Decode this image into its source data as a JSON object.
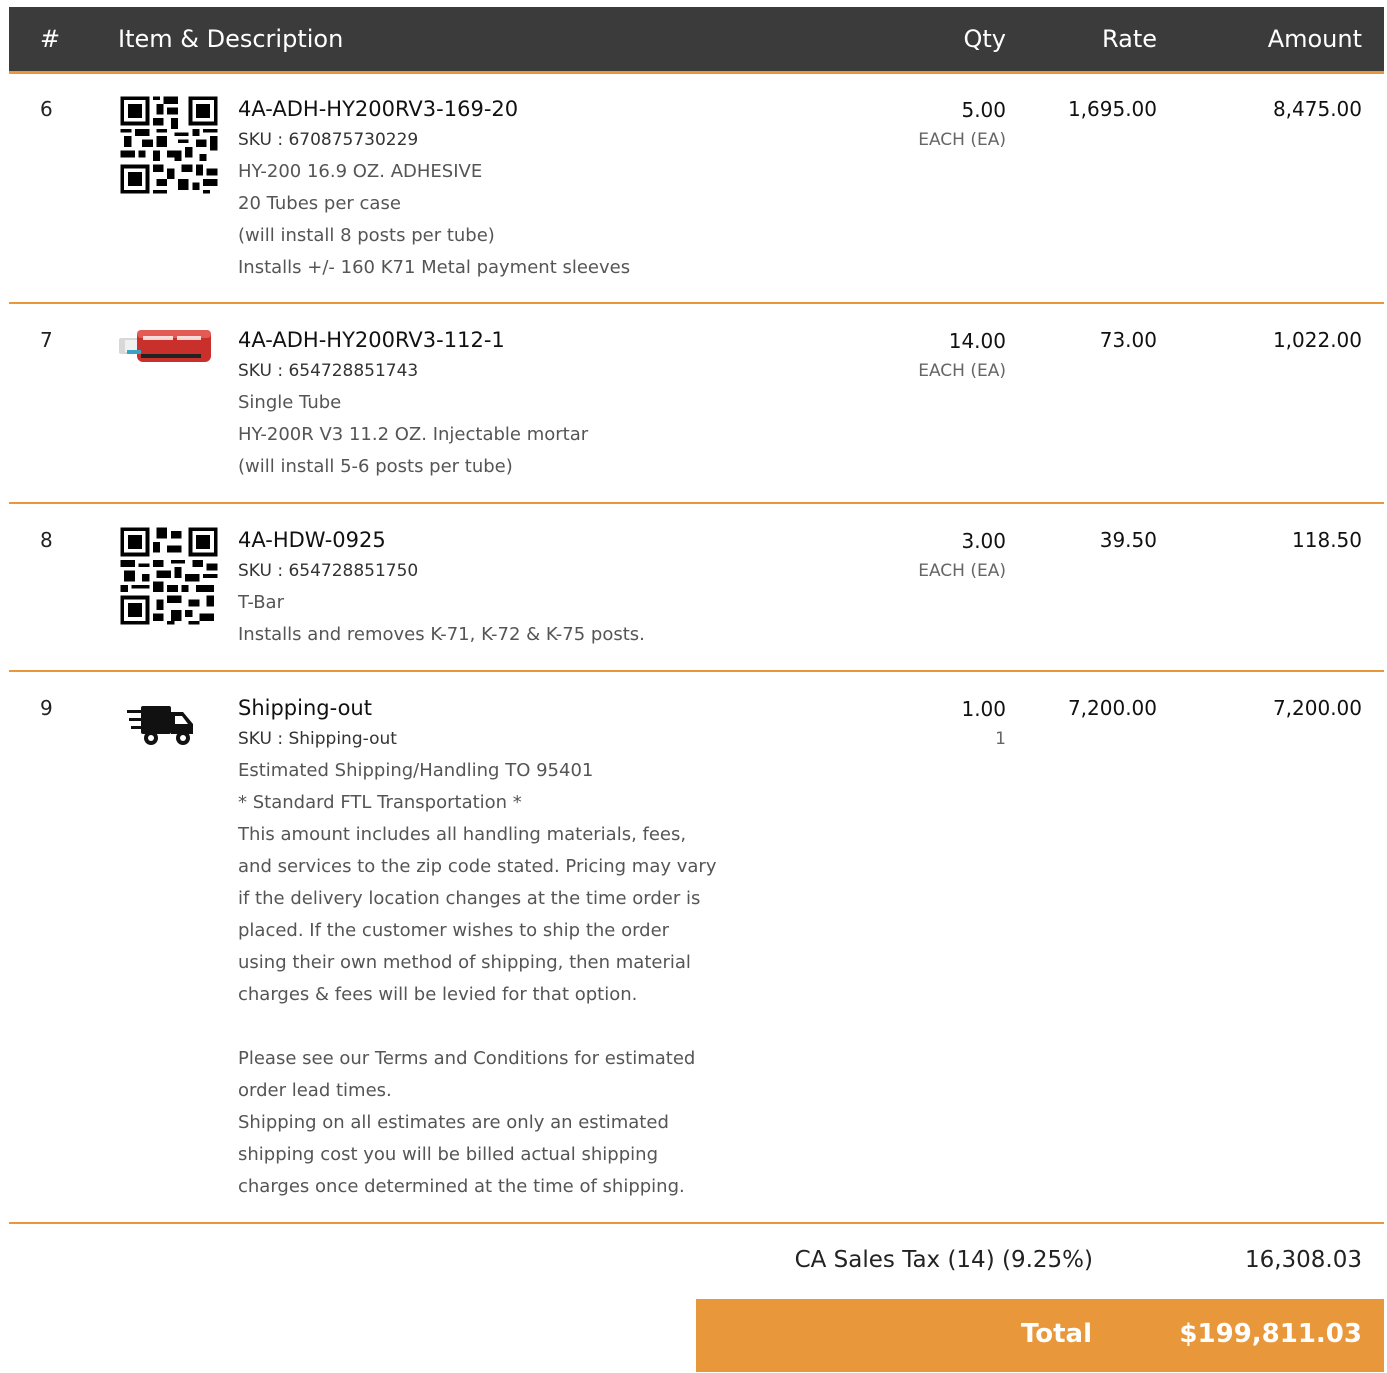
{
  "table_header": {
    "num": "#",
    "item": "Item & Description",
    "qty": "Qty",
    "rate": "Rate",
    "amount": "Amount"
  },
  "items": [
    {
      "num": "6",
      "image": "qr-code",
      "name": "4A-ADH-HY200RV3-169-20",
      "sku": "SKU : 670875730229",
      "lines": [
        "HY-200 16.9 OZ. ADHESIVE",
        "20 Tubes per case",
        "(will install 8 posts per tube)",
        "Installs +/- 160 K71 Metal payment sleeves"
      ],
      "qty": "5.00",
      "unit": "EACH (EA)",
      "rate": "1,695.00",
      "amount": "8,475.00"
    },
    {
      "num": "7",
      "image": "adhesive-tube",
      "name": "4A-ADH-HY200RV3-112-1",
      "sku": "SKU : 654728851743",
      "lines": [
        "Single Tube",
        "HY-200R V3 11.2 OZ. Injectable mortar",
        "(will install 5-6 posts per tube)"
      ],
      "qty": "14.00",
      "unit": "EACH (EA)",
      "rate": "73.00",
      "amount": "1,022.00"
    },
    {
      "num": "8",
      "image": "qr-code",
      "name": "4A-HDW-0925",
      "sku": "SKU : 654728851750",
      "lines": [
        "T-Bar",
        "Installs and removes K-71, K-72 & K-75 posts."
      ],
      "qty": "3.00",
      "unit": "EACH (EA)",
      "rate": "39.50",
      "amount": "118.50"
    },
    {
      "num": "9",
      "image": "delivery-truck",
      "name": "Shipping-out",
      "sku": "SKU : Shipping-out",
      "lines": [
        "Estimated Shipping/Handling TO 95401",
        "* Standard FTL Transportation *",
        "This amount includes all handling materials, fees,",
        "and services to the zip code stated. Pricing may vary",
        "if the delivery location changes at the time order is",
        "placed. If the customer wishes to ship the order",
        "using their own method of shipping, then material",
        "charges & fees will be levied for that option.",
        "",
        "Please see our Terms and Conditions for estimated",
        "order lead times.",
        "Shipping on all estimates are only an estimated",
        "shipping cost you will be billed actual shipping",
        "charges once determined at the time of shipping."
      ],
      "qty": "1.00",
      "unit": "1",
      "rate": "7,200.00",
      "amount": "7,200.00"
    }
  ],
  "summary": {
    "tax_label": "CA Sales Tax (14) (9.25%)",
    "tax_value": "16,308.03",
    "total_label": "Total",
    "total_value": "$199,811.03"
  },
  "colors": {
    "header_bg": "#3b3b3b",
    "accent": "#e8983a"
  }
}
